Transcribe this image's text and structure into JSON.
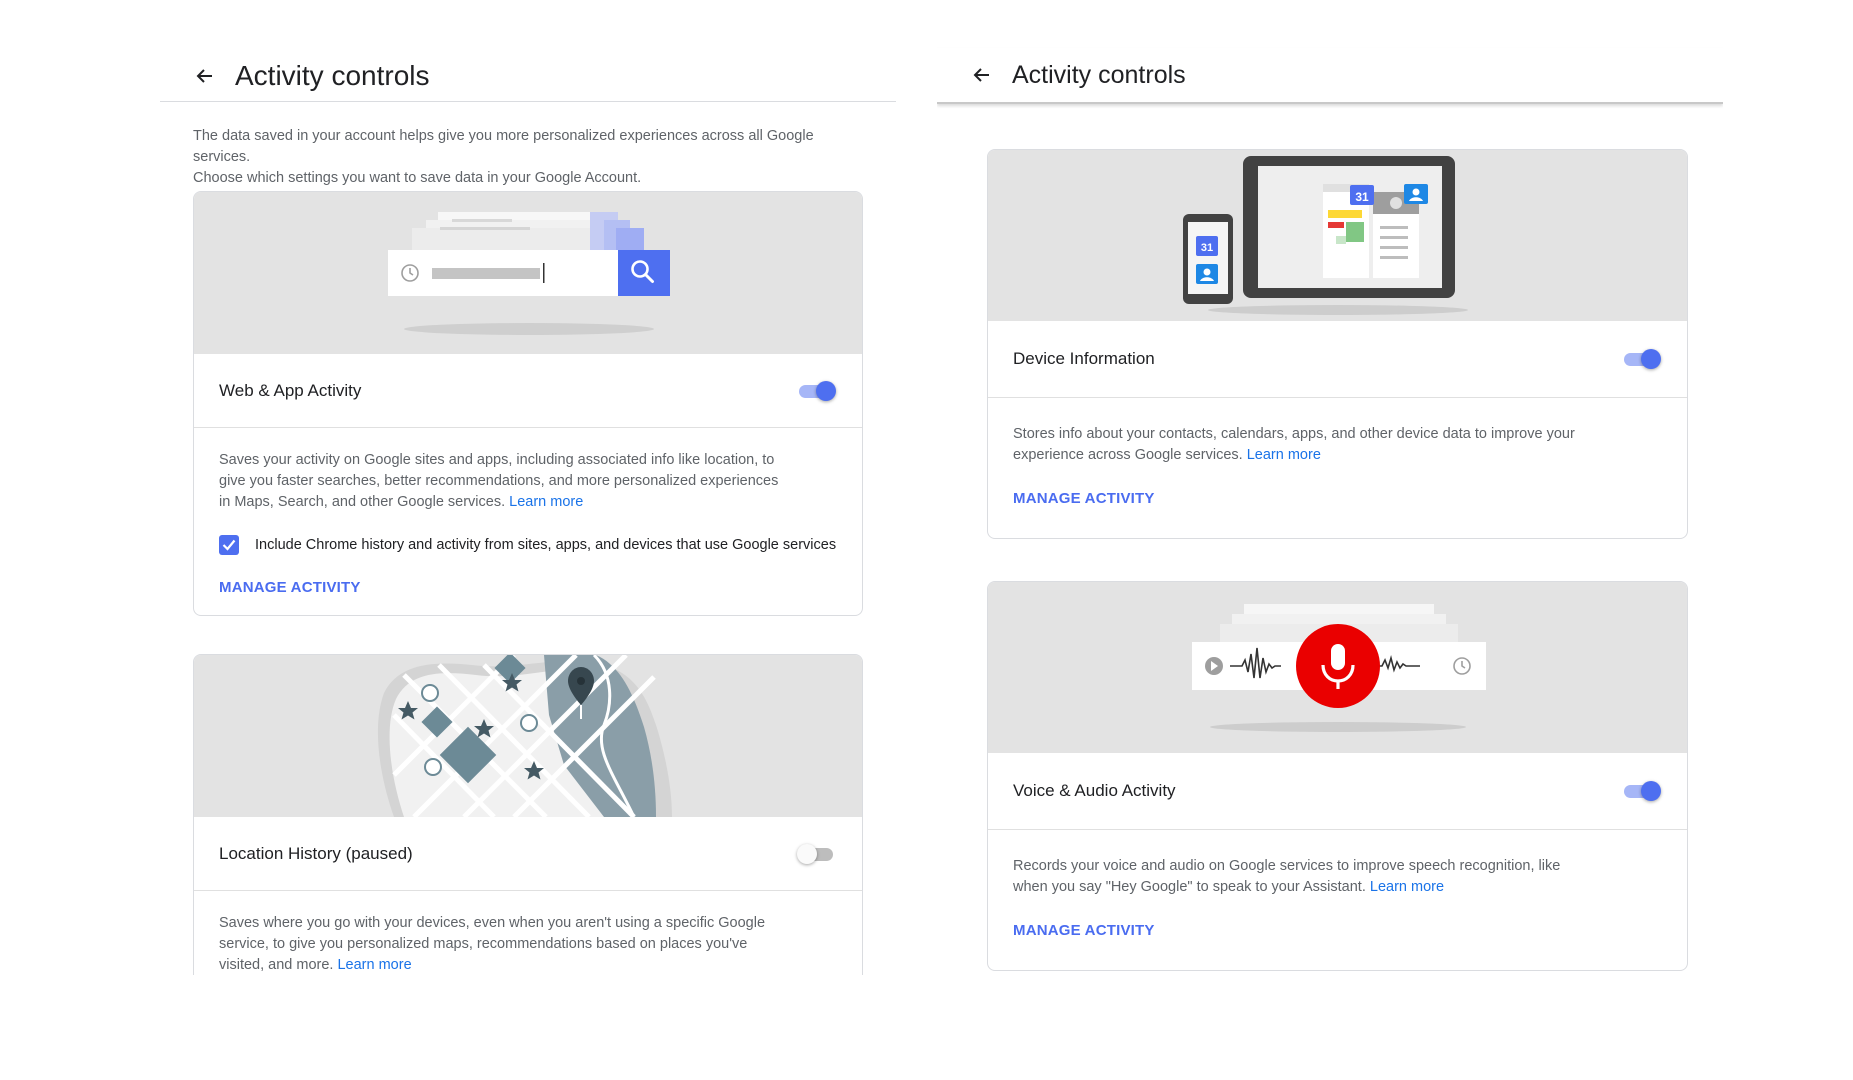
{
  "left": {
    "title": "Activity controls",
    "intro": {
      "line1": "The data saved in your account helps give you more personalized experiences across all Google services.",
      "line2": "Choose which settings you want to save data in your Google Account."
    },
    "web_app": {
      "label": "Web & App Activity",
      "enabled": true,
      "desc_line1": "Saves your activity on Google sites and apps, including associated info like location, to",
      "desc_line2": "give you faster searches, better recommendations, and more personalized experiences",
      "desc_line3": "in Maps, Search, and other Google services.",
      "learn_more": "Learn more",
      "checkbox_label": "Include Chrome history and activity from sites, apps, and devices that use Google services",
      "checkbox_checked": true,
      "manage": "MANAGE ACTIVITY"
    },
    "location": {
      "label": "Location History (paused)",
      "enabled": false,
      "desc_line1": "Saves where you go with your devices, even when you aren't using a specific Google",
      "desc_line2": "service, to give you personalized maps, recommendations based on places you've",
      "desc_line3": "visited, and more.",
      "learn_more": "Learn more"
    }
  },
  "right": {
    "title": "Activity controls",
    "device": {
      "label": "Device Information",
      "enabled": true,
      "desc_line1": "Stores info about your contacts, calendars, apps, and other device data to improve your",
      "desc_line2": "experience across Google services.",
      "learn_more": "Learn more",
      "manage": "MANAGE ACTIVITY",
      "calendar_day": "31"
    },
    "voice": {
      "label": "Voice & Audio Activity",
      "enabled": true,
      "desc_line1": "Records your voice and audio on Google services to improve speech recognition, like",
      "desc_line2": "when you say \"Hey Google\" to speak to your Assistant.",
      "learn_more": "Learn more",
      "manage": "MANAGE ACTIVITY"
    }
  },
  "colors": {
    "accent": "#4e6ff0",
    "link": "#1a73e8",
    "illustration_bg": "#e3e3e3",
    "mic_red": "#ea0000",
    "map_blue": "#6c8a96"
  },
  "icons": [
    "back-arrow-icon",
    "search-icon",
    "history-clock-icon",
    "checkmark-icon",
    "map-pin-icon",
    "star-icon",
    "microphone-icon",
    "play-icon",
    "calendar-icon",
    "contacts-icon"
  ]
}
